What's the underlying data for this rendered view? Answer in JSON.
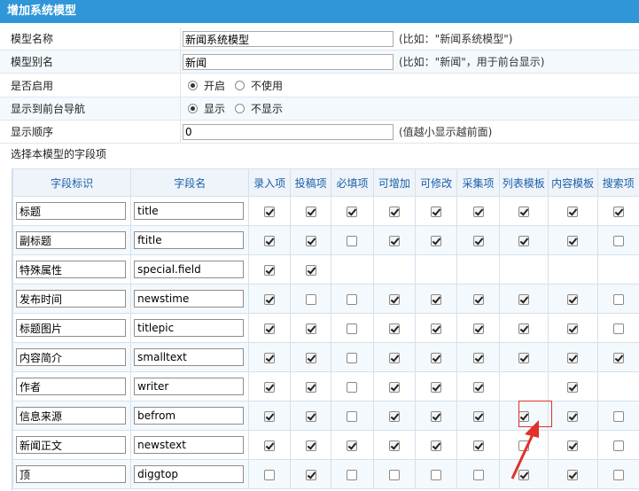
{
  "panel": {
    "title": "增加系统模型"
  },
  "form": {
    "model_name": {
      "label": "模型名称",
      "value": "新闻系统模型",
      "hint": "(比如：\"新闻系统模型\")"
    },
    "model_alias": {
      "label": "模型别名",
      "value": "新闻",
      "hint": "(比如：\"新闻\"，用于前台显示)"
    },
    "enabled": {
      "label": "是否启用",
      "options": [
        "开启",
        "不使用"
      ],
      "selected": "开启"
    },
    "nav": {
      "label": "显示到前台导航",
      "options": [
        "显示",
        "不显示"
      ],
      "selected": "显示"
    },
    "order": {
      "label": "显示顺序",
      "value": "0",
      "hint": "(值越小显示越前面)"
    },
    "fields_label": "选择本模型的字段项"
  },
  "table": {
    "headers": [
      "字段标识",
      "字段名",
      "录入项",
      "投稿项",
      "必填项",
      "可增加",
      "可修改",
      "采集项",
      "列表模板",
      "内容模板",
      "搜索项"
    ],
    "rows": [
      {
        "label": "标题",
        "field": "title",
        "checks": [
          1,
          1,
          1,
          1,
          1,
          1,
          1,
          1,
          1
        ]
      },
      {
        "label": "副标题",
        "field": "ftitle",
        "checks": [
          1,
          1,
          0,
          1,
          1,
          1,
          1,
          1,
          0
        ]
      },
      {
        "label": "特殊属性",
        "field": "special.field",
        "checks": [
          1,
          1,
          null,
          null,
          null,
          null,
          null,
          null,
          null
        ]
      },
      {
        "label": "发布时间",
        "field": "newstime",
        "checks": [
          1,
          0,
          0,
          1,
          1,
          1,
          1,
          1,
          0
        ]
      },
      {
        "label": "标题图片",
        "field": "titlepic",
        "checks": [
          1,
          1,
          0,
          1,
          1,
          1,
          1,
          1,
          0
        ]
      },
      {
        "label": "内容简介",
        "field": "smalltext",
        "checks": [
          1,
          1,
          0,
          1,
          1,
          1,
          1,
          1,
          1
        ]
      },
      {
        "label": "作者",
        "field": "writer",
        "checks": [
          1,
          1,
          0,
          1,
          1,
          1,
          null,
          1,
          null
        ]
      },
      {
        "label": "信息来源",
        "field": "befrom",
        "checks": [
          1,
          1,
          0,
          1,
          1,
          1,
          1,
          1,
          0
        ]
      },
      {
        "label": "新闻正文",
        "field": "newstext",
        "checks": [
          1,
          1,
          1,
          1,
          1,
          1,
          0,
          1,
          0
        ]
      },
      {
        "label": "顶",
        "field": "diggtop",
        "checks": [
          0,
          1,
          0,
          0,
          0,
          0,
          1,
          1,
          0
        ]
      }
    ]
  }
}
